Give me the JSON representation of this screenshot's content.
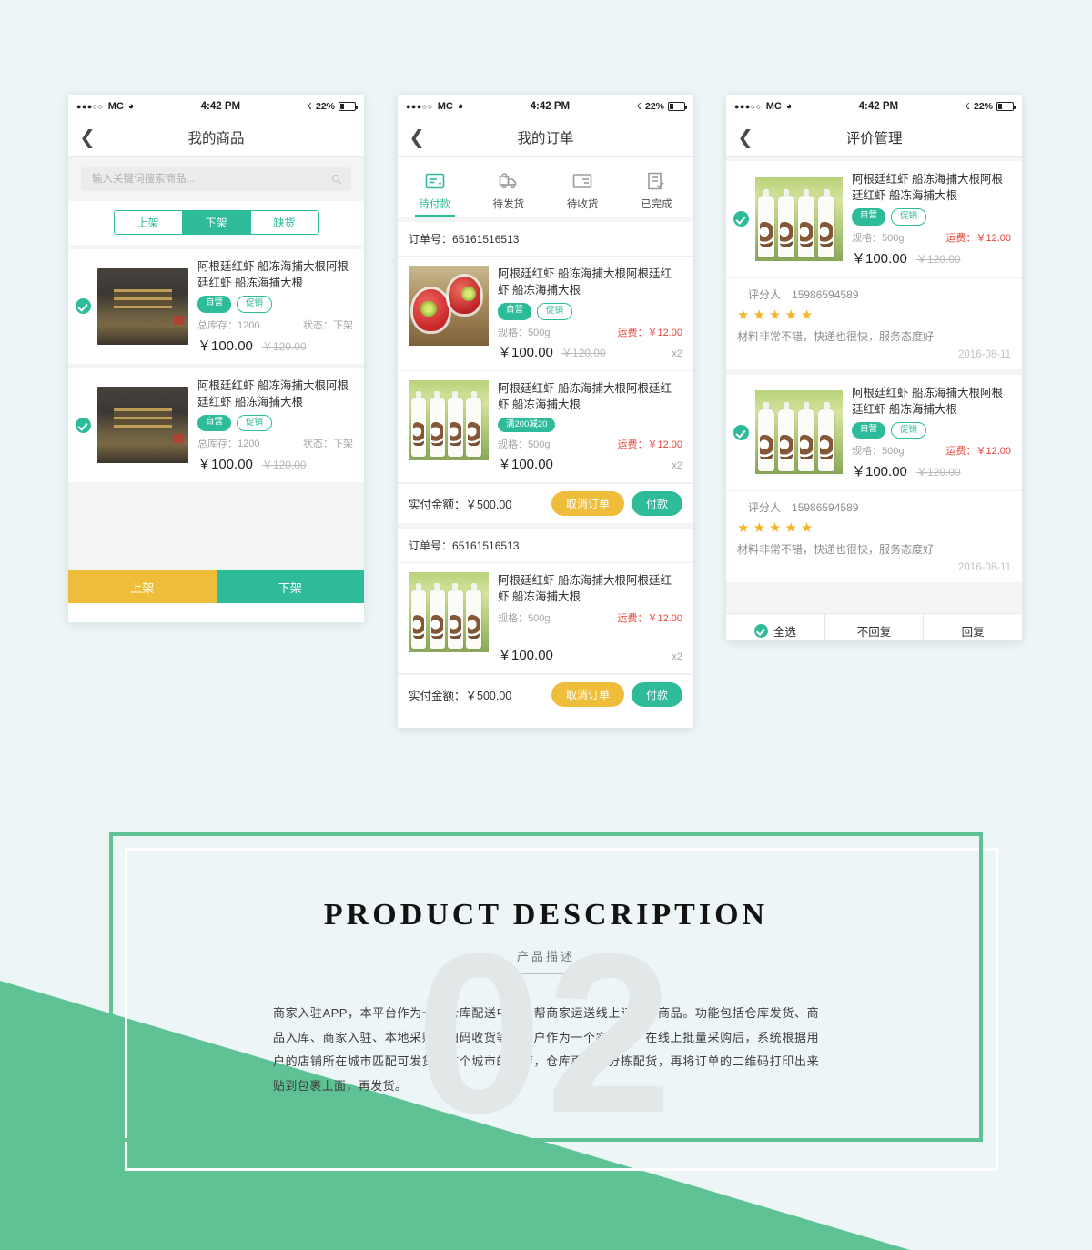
{
  "status_bar": {
    "signal_dots": "●●●○○",
    "carrier": "MC",
    "wifi_icon": "wifi-icon",
    "time": "4:42 PM",
    "bluetooth_icon": "bluetooth-icon",
    "battery_percent": "22%"
  },
  "screen1": {
    "title": "我的商品",
    "back_icon": "back-chevron-icon",
    "search": {
      "placeholder": "输入关键词搜索商品...",
      "value": "",
      "icon": "search-icon"
    },
    "segments": [
      {
        "label": "上架",
        "active": false
      },
      {
        "label": "下架",
        "active": true
      },
      {
        "label": "缺货",
        "active": false
      }
    ],
    "products": [
      {
        "checked": true,
        "image": "restaurant-interior-photo",
        "title": "阿根廷红虾 船冻海捕大根阿根廷红虾 船冻海捕大根",
        "tags": [
          "自营",
          "促销"
        ],
        "stock_label": "总库存：",
        "stock_value": "1200",
        "status_label": "状态：",
        "status_value": "下架",
        "price": "￥100.00",
        "old_price": "￥120.00"
      },
      {
        "checked": true,
        "image": "restaurant-interior-photo",
        "title": "阿根廷红虾 船冻海捕大根阿根廷红虾 船冻海捕大根",
        "tags": [
          "自营",
          "促销"
        ],
        "stock_label": "总库存：",
        "stock_value": "1200",
        "status_label": "状态：",
        "status_value": "下架",
        "price": "￥100.00",
        "old_price": "￥120.00"
      }
    ],
    "bottom_buttons": [
      {
        "label": "上架",
        "color": "#eebd3a"
      },
      {
        "label": "下架",
        "color": "#2dbb9a"
      }
    ]
  },
  "screen2": {
    "title": "我的订单",
    "back_icon": "back-chevron-icon",
    "tabs": [
      {
        "label": "待付款",
        "icon": "wallet-icon",
        "active": true
      },
      {
        "label": "待发货",
        "icon": "truck-icon",
        "active": false
      },
      {
        "label": "待收货",
        "icon": "box-icon",
        "active": false
      },
      {
        "label": "已完成",
        "icon": "checked-document-icon",
        "active": false
      }
    ],
    "orders": [
      {
        "order_label": "订单号：",
        "order_no": "65161516513",
        "items": [
          {
            "image": "cocktail-photo",
            "title": "阿根廷红虾 船冻海捕大根阿根廷红虾 船冻海捕大根",
            "tags": [
              "自营",
              "促销"
            ],
            "spec_label": "规格：",
            "spec_value": "500g",
            "shipping": "运费：￥12.00",
            "price": "￥100.00",
            "old_price": "￥120.00",
            "qty": "x2"
          },
          {
            "image": "coconut-bottles-photo",
            "title": "阿根廷红虾 船冻海捕大根阿根廷红虾 船冻海捕大根",
            "tags": [
              "满200减20"
            ],
            "spec_label": "规格：",
            "spec_value": "500g",
            "shipping": "运费：￥12.00",
            "price": "￥100.00",
            "old_price": "",
            "qty": "x2"
          }
        ],
        "total_label": "实付金额：",
        "total_value": "￥500.00",
        "buttons": [
          {
            "label": "取消订单",
            "style": "cancel"
          },
          {
            "label": "付款",
            "style": "pay"
          }
        ]
      },
      {
        "order_label": "订单号：",
        "order_no": "65161516513",
        "items": [
          {
            "image": "coconut-bottles-photo",
            "title": "阿根廷红虾 船冻海捕大根阿根廷红虾 船冻海捕大根",
            "tags": [],
            "spec_label": "规格：",
            "spec_value": "500g",
            "shipping": "运费：￥12.00",
            "price": "￥100.00",
            "old_price": "",
            "qty": "x2"
          }
        ],
        "total_label": "实付金额：",
        "total_value": "￥500.00",
        "buttons": [
          {
            "label": "取消订单",
            "style": "cancel"
          },
          {
            "label": "付款",
            "style": "pay"
          }
        ]
      }
    ]
  },
  "screen3": {
    "title": "评价管理",
    "back_icon": "back-chevron-icon",
    "reviews": [
      {
        "checked": true,
        "image": "coconut-bottles-photo",
        "title": "阿根廷红虾 船冻海捕大根阿根廷红虾 船冻海捕大根",
        "tags": [
          "自营",
          "促销"
        ],
        "spec_label": "规格：",
        "spec_value": "500g",
        "shipping": "运费：￥12.00",
        "price": "￥100.00",
        "old_price": "￥120.00",
        "rater_label": "评分人",
        "rater_phone": "15986594589",
        "stars": 5,
        "comment": "材料非常不错，快递也很快，服务态度好",
        "date": "2016-08-11"
      },
      {
        "checked": true,
        "image": "coconut-bottles-photo",
        "title": "阿根廷红虾 船冻海捕大根阿根廷红虾 船冻海捕大根",
        "tags": [
          "自营",
          "促销"
        ],
        "spec_label": "规格：",
        "spec_value": "500g",
        "shipping": "运费：￥12.00",
        "price": "￥100.00",
        "old_price": "￥120.00",
        "rater_label": "评分人",
        "rater_phone": "15986594589",
        "stars": 5,
        "comment": "材料非常不错，快递也很快，服务态度好",
        "date": "2016-08-11"
      }
    ],
    "bottom_buttons": [
      {
        "label": "全选",
        "icon": "check-circle-icon"
      },
      {
        "label": "不回复",
        "icon": ""
      },
      {
        "label": "回复",
        "icon": ""
      }
    ]
  },
  "description_section": {
    "watermark": "02",
    "title": "PRODUCT DESCRIPTION",
    "subtitle": "产品描述",
    "body": "商家入驻APP，本平台作为一个仓库配送中心，帮商家运送线上订购的商品。功能包括仓库发货、商品入库、商家入驻、本地采购、扫码收货等。用户作为一个实体店，在线上批量采购后，系统根据用户的店铺所在城市匹配可发货到这个城市的仓库，仓库再进行分拣配货，再将订单的二维码打印出来贴到包裹上面，再发货。"
  },
  "theme": {
    "accent_green": "#2dbb9a",
    "frame_green": "#5ec295",
    "yellow": "#eebd3a",
    "red": "#e8453c",
    "star_yellow": "#f5b426",
    "page_bg": "#edf5f7"
  }
}
